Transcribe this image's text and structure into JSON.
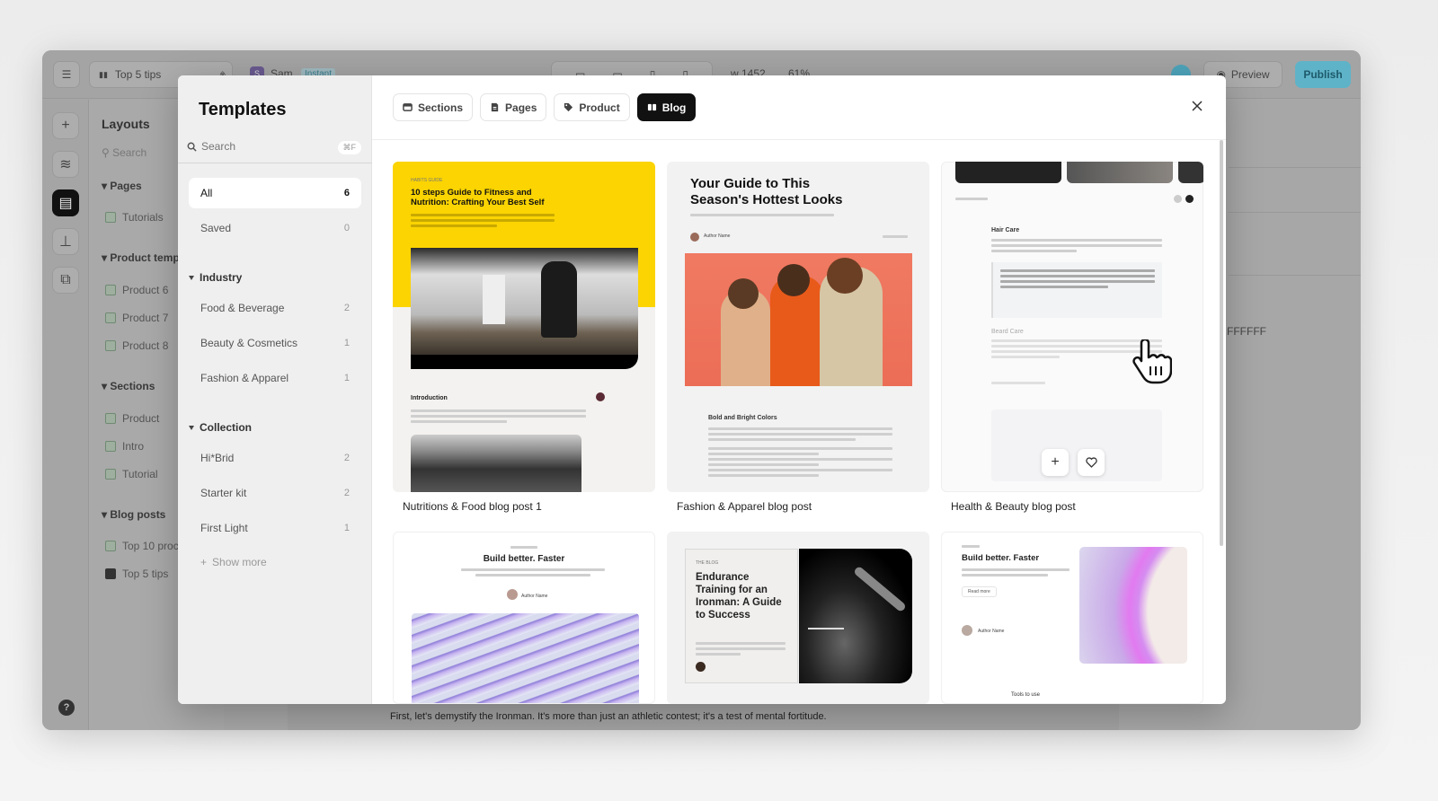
{
  "app": {
    "topbar": {
      "menu_icon": "hamburger-icon",
      "page_selector": "Top 5 tips",
      "user_initial": "S",
      "user_name": "Sam",
      "user_badge": "Instant",
      "width_readout": "w 1452",
      "zoom_readout": "61%",
      "preview_label": "Preview",
      "publish_label": "Publish",
      "accent_color": "#5fb3c8"
    },
    "rail": [
      "add-icon",
      "layers-icon",
      "pages-icon",
      "stamp-icon",
      "media-icon"
    ],
    "layouts": {
      "title": "Layouts",
      "search_placeholder": "Search",
      "groups": [
        {
          "label": "Pages",
          "items": [
            "Tutorials"
          ]
        },
        {
          "label": "Product temp",
          "items": [
            "Product 6",
            "Product 7",
            "Product 8"
          ]
        },
        {
          "label": "Sections",
          "items": [
            "Product",
            "Intro",
            "Tutorial"
          ]
        },
        {
          "label": "Blog posts",
          "items": [
            "Top 10 proc",
            "Top 5 tips"
          ]
        }
      ]
    },
    "canvas_text": "First, let's demystify the Ironman. It's more than just an athletic contest; it's a test of mental fortitude.",
    "right_panel_value": "FFFFFF"
  },
  "modal": {
    "title": "Templates",
    "search_placeholder": "Search",
    "search_shortcut": "⌘F",
    "filters": [
      {
        "label": "All",
        "count": "6"
      },
      {
        "label": "Saved",
        "count": "0"
      }
    ],
    "industry": {
      "label": "Industry",
      "items": [
        {
          "label": "Food & Beverage",
          "count": "2"
        },
        {
          "label": "Beauty & Cosmetics",
          "count": "1"
        },
        {
          "label": "Fashion & Apparel",
          "count": "1"
        }
      ]
    },
    "collection": {
      "label": "Collection",
      "items": [
        {
          "label": "Hi*Brid",
          "count": "2"
        },
        {
          "label": "Starter kit",
          "count": "2"
        },
        {
          "label": "First Light",
          "count": "1"
        }
      ]
    },
    "show_more": "Show more",
    "tabs": [
      {
        "label": "Sections",
        "icon": "section-icon"
      },
      {
        "label": "Pages",
        "icon": "page-icon"
      },
      {
        "label": "Product",
        "icon": "tag-icon"
      },
      {
        "label": "Blog",
        "icon": "blog-icon",
        "active": true
      }
    ],
    "cards": [
      {
        "label": "Nutritions & Food blog post 1",
        "headline": "10 steps Guide to Fitness and Nutrition: Crafting Your Best Self",
        "section": "Introduction",
        "accent": "#fbd402"
      },
      {
        "label": "Fashion & Apparel blog post",
        "headline": "Your Guide to This Season's Hottest Looks",
        "author": "Author Name",
        "section": "Bold and Bright Colors"
      },
      {
        "label": "Health & Beauty blog post",
        "section1": "Hair Care",
        "section2": "Beard Care",
        "add_label": "+",
        "save_icon": "heart-icon"
      },
      {
        "label": "",
        "headline": "Build better. Faster",
        "author": "Author Name"
      },
      {
        "label": "",
        "headline": "Endurance Training for an Ironman: A Guide to Success",
        "kicker": "THE BLOG"
      },
      {
        "label": "",
        "headline": "Build better. Faster",
        "cta": "Read more",
        "author": "Author Name",
        "footer": "Tools to use"
      }
    ]
  }
}
